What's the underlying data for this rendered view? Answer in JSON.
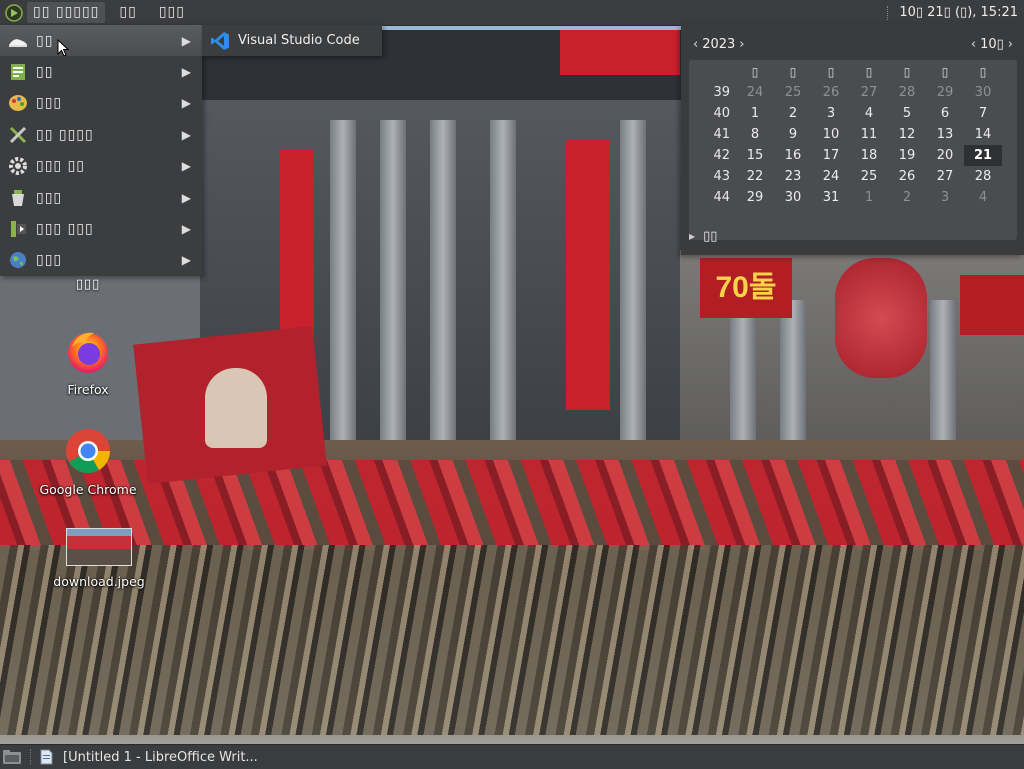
{
  "top_panel": {
    "menu_button_label": "▯▯ ▯▯▯▯▯",
    "places_label": "▯▯",
    "system_label": "▯▯▯",
    "clock": "10▯ 21▯ (▯), 15:21"
  },
  "app_menu": {
    "items": [
      {
        "label": "▯▯",
        "icon": "hat-icon",
        "active": true
      },
      {
        "label": "▯▯",
        "icon": "office-icon"
      },
      {
        "label": "▯▯▯",
        "icon": "graphics-icon"
      },
      {
        "label": "▯▯ ▯▯▯▯",
        "icon": "tools-icon"
      },
      {
        "label": "▯▯▯ ▯▯",
        "icon": "settings-gear-icon"
      },
      {
        "label": "▯▯▯",
        "icon": "system-tools-icon"
      },
      {
        "label": "▯▯▯ ▯▯▯",
        "icon": "multimedia-icon"
      },
      {
        "label": "▯▯▯",
        "icon": "internet-globe-icon"
      }
    ],
    "submenu_item": "Visual Studio Code"
  },
  "calendar": {
    "year": "2023",
    "month": "10▯",
    "weekdays": [
      "▯",
      "▯",
      "▯",
      "▯",
      "▯",
      "▯",
      "▯"
    ],
    "weeks": [
      {
        "wk": "39",
        "days": [
          "24",
          "25",
          "26",
          "27",
          "28",
          "29",
          "30"
        ],
        "muted": [
          0,
          1,
          2,
          3,
          4,
          5,
          6
        ]
      },
      {
        "wk": "40",
        "days": [
          "1",
          "2",
          "3",
          "4",
          "5",
          "6",
          "7"
        ],
        "muted": []
      },
      {
        "wk": "41",
        "days": [
          "8",
          "9",
          "10",
          "11",
          "12",
          "13",
          "14"
        ],
        "muted": []
      },
      {
        "wk": "42",
        "days": [
          "15",
          "16",
          "17",
          "18",
          "19",
          "20",
          "21"
        ],
        "muted": [],
        "today": 6
      },
      {
        "wk": "43",
        "days": [
          "22",
          "23",
          "24",
          "25",
          "26",
          "27",
          "28"
        ],
        "muted": []
      },
      {
        "wk": "44",
        "days": [
          "29",
          "30",
          "31",
          "1",
          "2",
          "3",
          "4"
        ],
        "muted": [
          3,
          4,
          5,
          6
        ]
      }
    ],
    "events_label": "▯▯"
  },
  "desktop": {
    "home_label": "▯▯▯",
    "icons": [
      {
        "label": "Firefox"
      },
      {
        "label": "Google Chrome"
      },
      {
        "label": "download.jpeg"
      }
    ],
    "wall_sign": "70돌"
  },
  "bottom_panel": {
    "task": "[Untitled 1 - LibreOffice Writ..."
  },
  "colors": {
    "panel": "#3b3c3e",
    "menu": "#3c3d3f",
    "accent_red": "#c8202c"
  }
}
